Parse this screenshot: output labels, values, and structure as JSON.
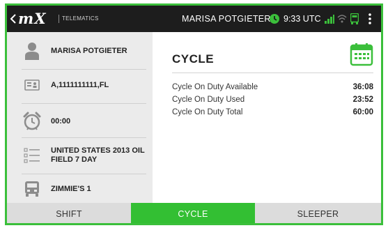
{
  "header": {
    "logo": "mX",
    "logo_sub": "TELEMATICS",
    "driver_name": "MARISA POTGIETER",
    "time": "9:33 UTC",
    "icons": [
      "back-chevron-icon",
      "clock-status-icon",
      "signal-icon",
      "wifi-icon",
      "truck-status-icon",
      "overflow-menu-icon"
    ]
  },
  "sidebar": {
    "items": [
      {
        "icon": "person-icon",
        "label": "MARISA POTGIETER"
      },
      {
        "icon": "id-card-icon",
        "label": "A,1111111111,FL"
      },
      {
        "icon": "alarm-clock-icon",
        "label": "00:00"
      },
      {
        "icon": "ruleset-icon",
        "label": "UNITED STATES 2013 OIL FIELD 7 DAY"
      },
      {
        "icon": "truck-icon",
        "label": "ZIMMIE'S 1"
      }
    ]
  },
  "main": {
    "title": "CYCLE",
    "icon": "calendar-icon",
    "rows": [
      {
        "label": "Cycle On Duty Available",
        "value": "36:08"
      },
      {
        "label": "Cycle On Duty Used",
        "value": "23:52"
      },
      {
        "label": "Cycle On Duty Total",
        "value": "60:00"
      }
    ]
  },
  "tabs": [
    {
      "label": "SHIFT",
      "active": false
    },
    {
      "label": "CYCLE",
      "active": true
    },
    {
      "label": "SLEEPER",
      "active": false
    }
  ],
  "colors": {
    "accent": "#33bf33",
    "topbar": "#1d1d1d",
    "sidebar": "#ebebeb",
    "tab_inactive": "#dcdcdc"
  }
}
